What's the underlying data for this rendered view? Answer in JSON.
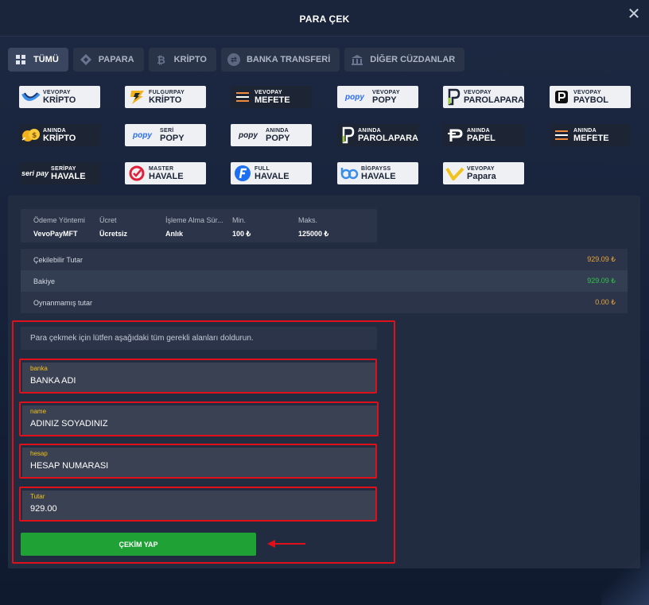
{
  "header": {
    "title": "PARA ÇEK",
    "close_symbol": "✕"
  },
  "tabs": [
    {
      "label": "TÜMÜ",
      "icon": "grid-icon",
      "active": true
    },
    {
      "label": "PAPARA",
      "icon": "papara-icon",
      "active": false
    },
    {
      "label": "KRİPTO",
      "icon": "bitcoin-icon",
      "active": false
    },
    {
      "label": "BANKA TRANSFERİ",
      "icon": "transfer-icon",
      "active": false
    },
    {
      "label": "DİĞER CÜZDANLAR",
      "icon": "bank-icon",
      "active": false
    }
  ],
  "methods": [
    {
      "small": "VEVOPAY",
      "big": "KRİPTO"
    },
    {
      "small": "FULGURPAY",
      "big": "KRİPTO"
    },
    {
      "small": "VEVOPAY",
      "big": "MEFETE"
    },
    {
      "small": "VEVOPAY",
      "big": "POPY",
      "logo_text": "popy"
    },
    {
      "small": "VEVOPAY",
      "big": "PAROLAPARA"
    },
    {
      "small": "VEVOPAY",
      "big": "PAYBOL"
    },
    {
      "small": "ANINDA",
      "big": "KRİPTO"
    },
    {
      "small": "SERİ",
      "big": "POPY",
      "logo_text": "popy"
    },
    {
      "small": "ANINDA",
      "big": "POPY",
      "logo_text": "popy"
    },
    {
      "small": "ANINDA",
      "big": "PAROLAPARA"
    },
    {
      "small": "ANINDA",
      "big": "PAPEL"
    },
    {
      "small": "ANINDA",
      "big": "MEFETE"
    },
    {
      "small": "SERİPAY",
      "big": "HAVALE",
      "logo_text": "seri pay"
    },
    {
      "small": "MASTER",
      "big": "HAVALE"
    },
    {
      "small": "FULL",
      "big": "HAVALE"
    },
    {
      "small": "BİGPAYSS",
      "big": "HAVALE"
    },
    {
      "small": "VEVOPAY",
      "big": "Papara"
    }
  ],
  "info": {
    "headers": [
      "Ödeme Yöntemi",
      "Ücret",
      "İşleme Alma Sür...",
      "Min.",
      "Maks."
    ],
    "values": [
      "VevoPayMFT",
      "Ücretsiz",
      "Anlık",
      "100 ₺",
      "125000 ₺"
    ]
  },
  "balances": [
    {
      "label": "Çekilebilir Tutar",
      "value": "929.09 ₺",
      "color": "#e8a33c"
    },
    {
      "label": "Bakiye",
      "value": "929.09 ₺",
      "color": "#2fc24a"
    },
    {
      "label": "Oynanmamış tutar",
      "value": "0.00 ₺",
      "color": "#e8a33c"
    }
  ],
  "form": {
    "hint": "Para çekmek için lütfen aşağıdaki tüm gerekli alanları doldurun.",
    "fields": [
      {
        "label": "banka",
        "placeholder": "BANKA ADI",
        "value": ""
      },
      {
        "label": "name",
        "placeholder": "ADINIZ SOYADINIZ",
        "value": ""
      },
      {
        "label": "hesap",
        "placeholder": "HESAP NUMARASI",
        "value": ""
      },
      {
        "label": "Tutar",
        "placeholder": "",
        "value": "929.00"
      }
    ],
    "submit_label": "ÇEKİM YAP"
  },
  "colors": {
    "accent_red": "#e0101a",
    "button_green": "#1fa135",
    "label_yellow": "#f2c21b"
  }
}
